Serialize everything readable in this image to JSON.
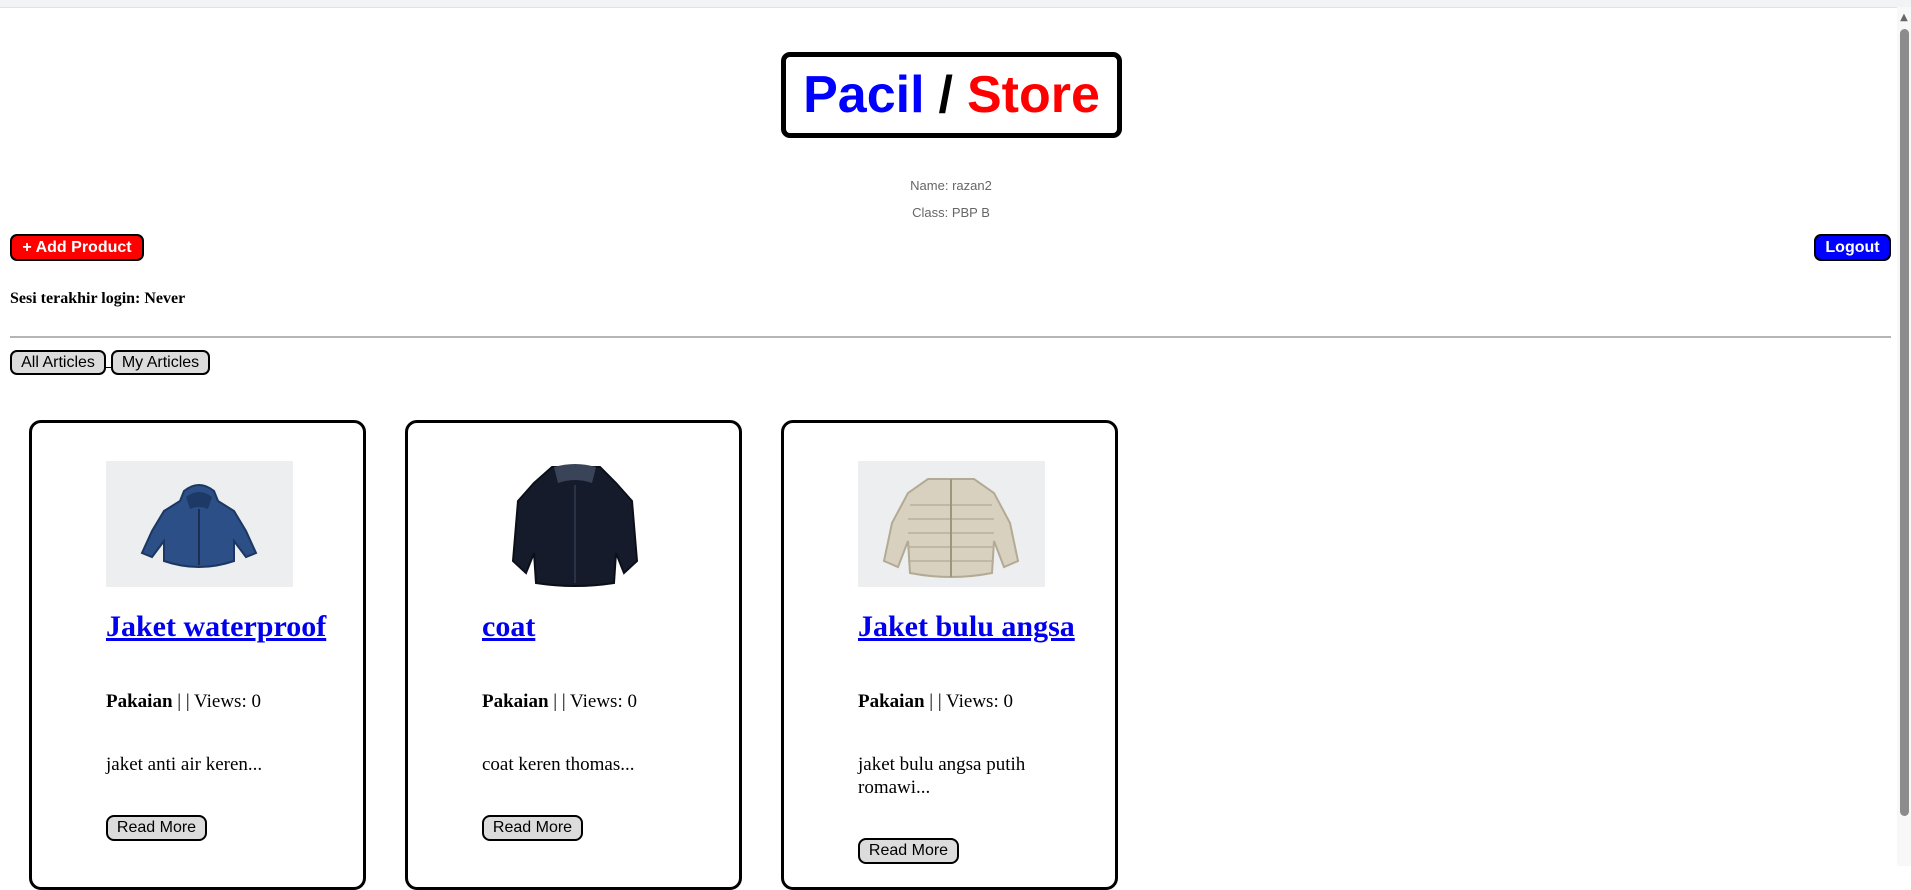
{
  "header": {
    "brand_left": "Pacil",
    "brand_sep": "/",
    "brand_right": "Store",
    "name_line": "Name: razan2",
    "class_line": "Class: PBP B"
  },
  "toolbar": {
    "add_label": "+ Add Product",
    "logout_label": "Logout"
  },
  "session": {
    "last_login": "Sesi terakhir login: Never"
  },
  "filters": {
    "all_label": "All Articles",
    "sep": "_",
    "mine_label": "My Articles"
  },
  "products": [
    {
      "title": "Jaket waterproof",
      "category": "Pakaian",
      "meta": " | | Views: 0",
      "description": "jaket anti air keren...",
      "read_more": "Read More"
    },
    {
      "title": "coat",
      "category": "Pakaian",
      "meta": " | | Views: 0",
      "description": "coat keren thomas...",
      "read_more": "Read More"
    },
    {
      "title": "Jaket bulu angsa",
      "category": "Pakaian",
      "meta": " | | Views: 0",
      "description": "jaket bulu angsa putih romawi...",
      "read_more": "Read More"
    }
  ],
  "colors": {
    "brand_blue": "#0000ff",
    "brand_red": "#ff0000",
    "link": "#0000ee"
  }
}
